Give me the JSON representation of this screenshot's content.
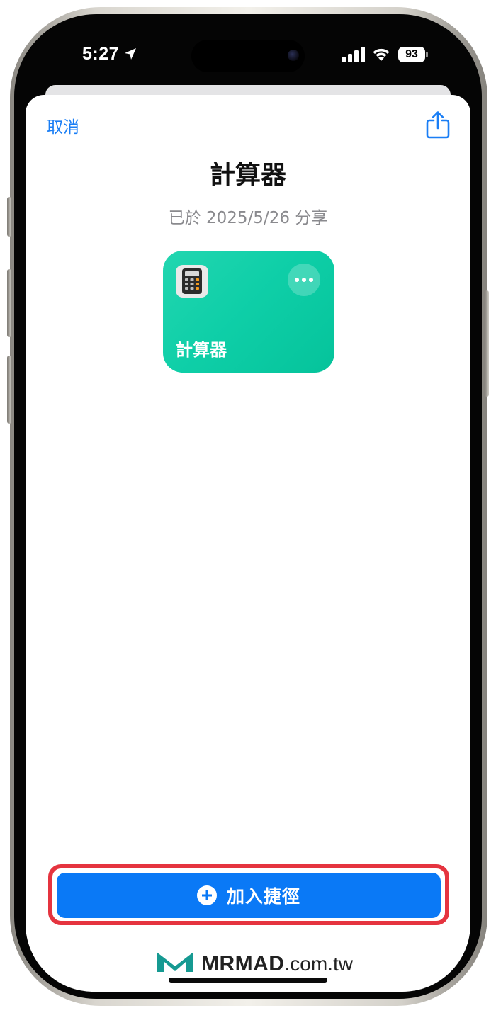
{
  "status_bar": {
    "time": "5:27",
    "battery": "93",
    "icons": [
      "location-arrow-icon",
      "cellular-signal-icon",
      "wifi-icon",
      "battery-icon"
    ]
  },
  "sheet": {
    "cancel_label": "取消",
    "share_icon": "share-icon",
    "title": "計算器",
    "subtitle": "已於 2025/5/26 分享"
  },
  "shortcut_tile": {
    "name": "計算器",
    "icon": "calculator-icon",
    "more_icon": "ellipsis-icon",
    "color": "#0fcfa8"
  },
  "add_button": {
    "label": "加入捷徑",
    "icon": "plus-circle-icon",
    "color": "#0a79f6",
    "highlight_color": "#e5343f"
  },
  "watermark": {
    "brand": "MRMAD",
    "domain": ".com.tw",
    "logo_color": "#169a92"
  }
}
